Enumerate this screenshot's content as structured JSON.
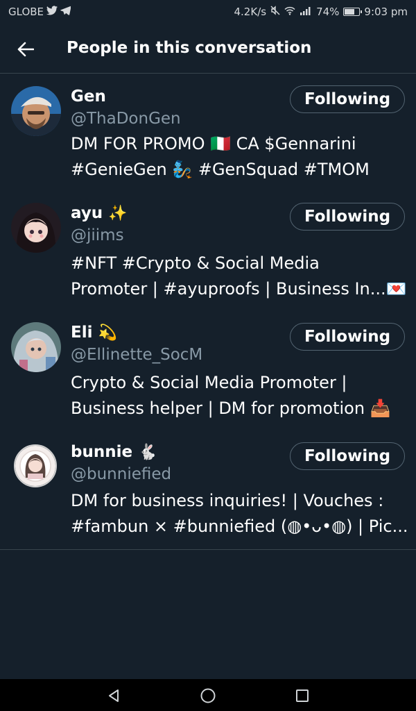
{
  "status_bar": {
    "carrier": "GLOBE",
    "speed": "4.2K/s",
    "battery_percent": "74%",
    "battery_level": 0.74,
    "time": "9:03 pm"
  },
  "header": {
    "title": "People in this conversation"
  },
  "people": [
    {
      "name": "Gen",
      "name_emoji": "",
      "handle": "@ThaDonGen",
      "button": "Following",
      "bio_lines": [
        "DM FOR PROMO 🇮🇹  CA $Gennarini",
        "#GenieGen 🧞 #GenSquad #TMOM"
      ]
    },
    {
      "name": "ayu",
      "name_emoji": "✨",
      "handle": "@jiims",
      "button": "Following",
      "bio_lines": [
        "#NFT #Crypto & Social Media",
        "Promoter | #ayuproofs | Business In...💌"
      ]
    },
    {
      "name": "Eli",
      "name_emoji": "💫",
      "handle": "@Ellinette_SocM",
      "button": "Following",
      "bio_lines": [
        "Crypto & Social Media Promoter |",
        "Business helper |  DM for promotion 📥"
      ]
    },
    {
      "name": "bunnie",
      "name_emoji": "🐇",
      "handle": "@bunniefied",
      "button": "Following",
      "bio_lines": [
        "DM for business inquiries! | Vouches :",
        "#fambun × #bunniefied (◍•ᴗ•◍) | Pic..."
      ]
    }
  ],
  "colors": {
    "background": "#15202b",
    "text_secondary": "#8899a6",
    "divider": "#38444d",
    "button_border": "#536471"
  }
}
